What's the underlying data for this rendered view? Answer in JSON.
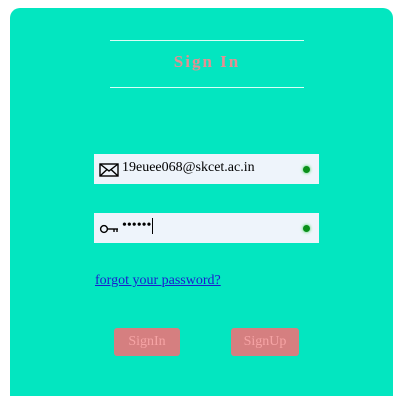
{
  "form": {
    "title": "Sign In",
    "email": {
      "value": "19euee068@skcet.ac.in",
      "icon": "envelope-icon"
    },
    "password": {
      "masked_value": "••••••",
      "icon": "key-icon"
    },
    "forgot_password_label": "forgot your password?",
    "signin_label": "SignIn",
    "signup_label": "SignUp"
  },
  "colors": {
    "background": "#03e6c0",
    "title": "#e58f92",
    "button_bg": "#d57f80",
    "button_text": "#f6a4a5",
    "link": "#1a1ad0",
    "field_bg": "#eef4fb",
    "status_dot": "#0a8f1a"
  }
}
